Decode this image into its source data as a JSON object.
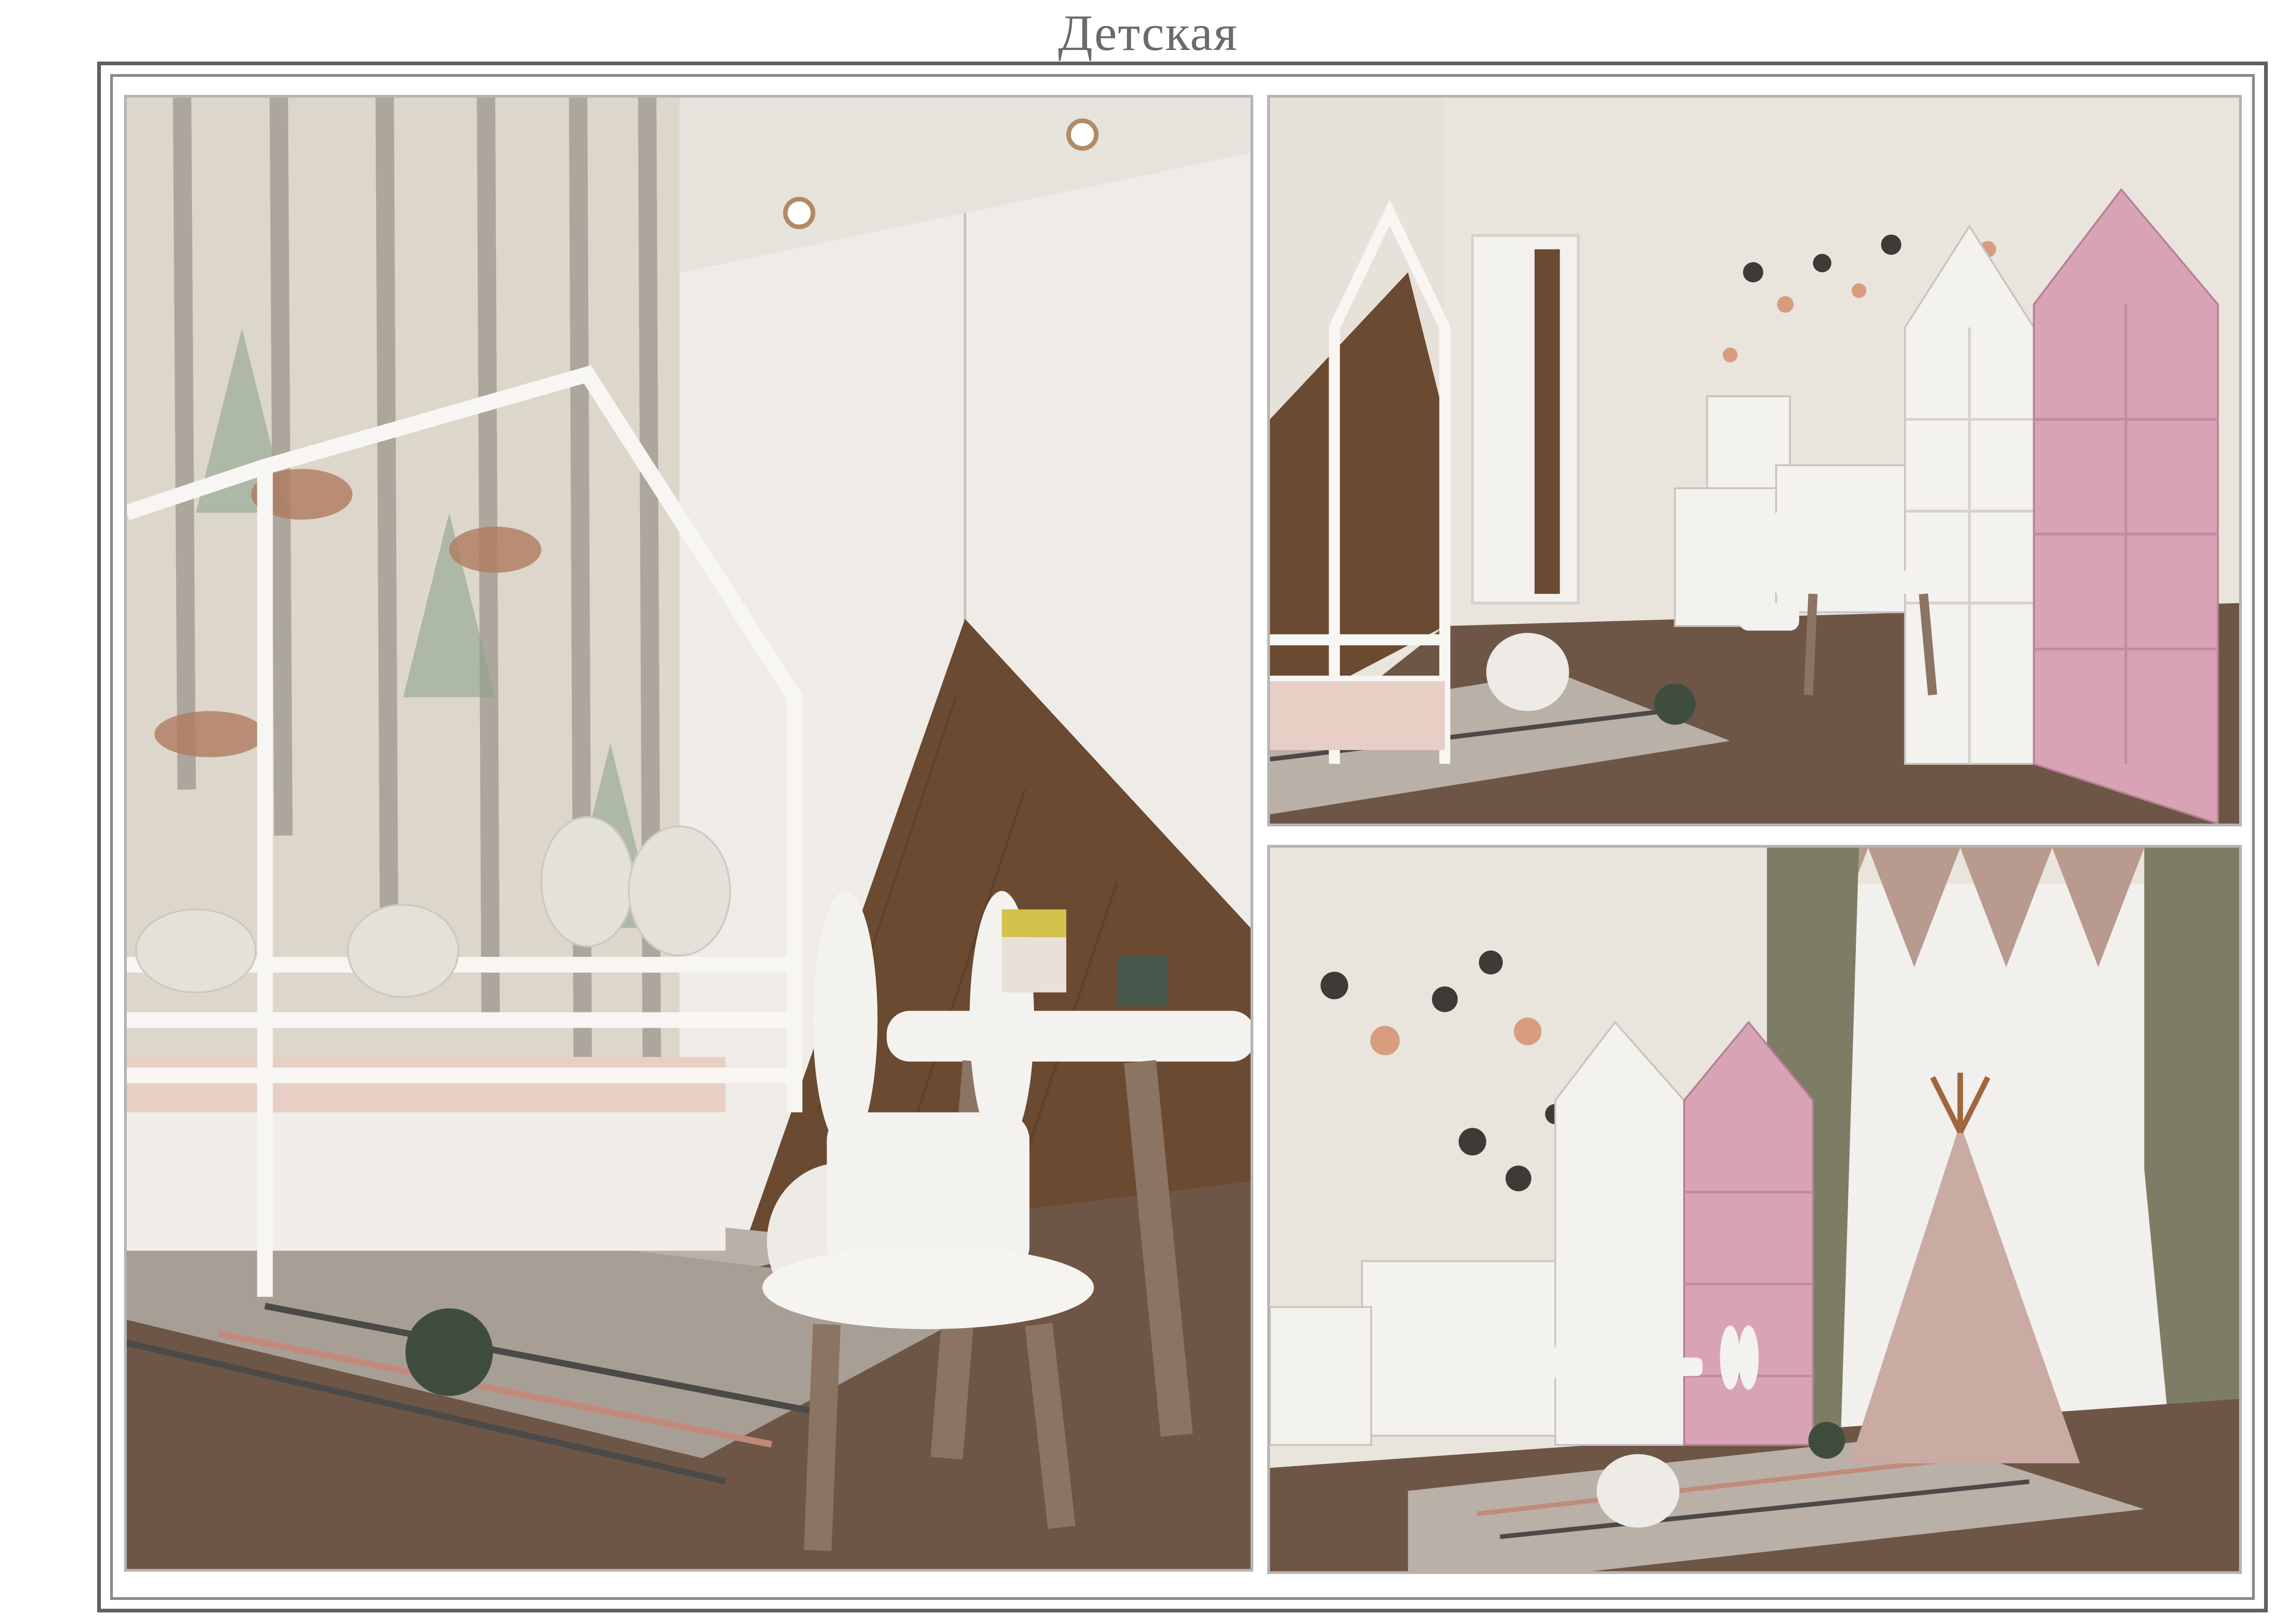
{
  "page": {
    "title": "Детская"
  },
  "panels": [
    {
      "id": "main",
      "subject": "bed-wardrobe-table-view"
    },
    {
      "id": "top-right",
      "subject": "shelves-kitchen-view"
    },
    {
      "id": "bottom-right",
      "subject": "window-teepee-view"
    }
  ],
  "colors": {
    "wall": "#e9e4dc",
    "wood_floor": "#6e5646",
    "wood_panel": "#6b4a32",
    "white_furniture": "#f4f2ef",
    "pink_shelf": "#d9a3b6",
    "curtain_green": "#7d7d66",
    "curtain_pink": "#b89a8e",
    "teepee": "#c9aba3"
  }
}
